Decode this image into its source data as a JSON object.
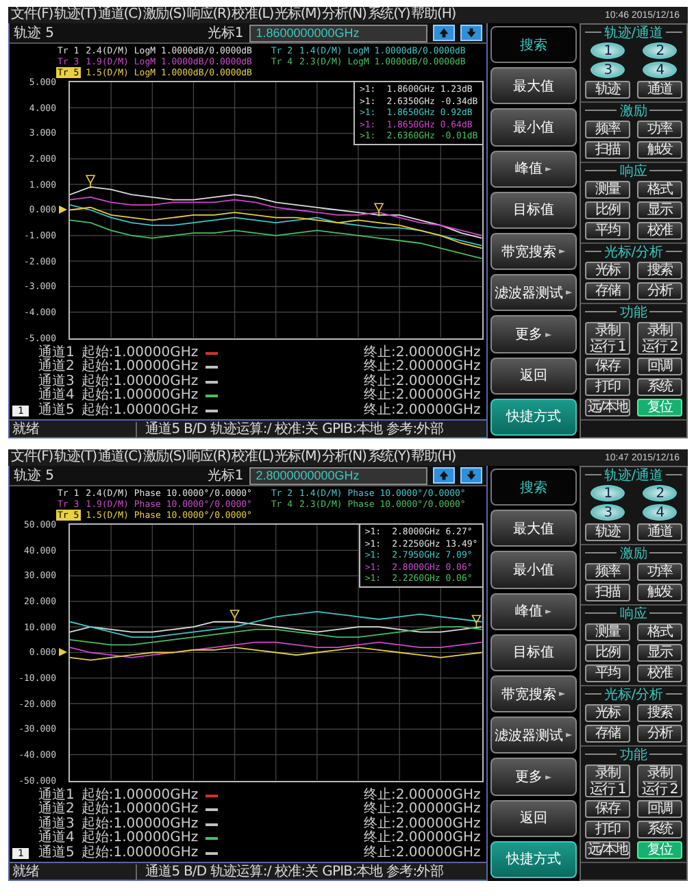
{
  "screens": [
    {
      "menu": [
        "文件(F)",
        "轨迹(T)",
        "通道(C)",
        "激励(S)",
        "响应(R)",
        "校准(L)",
        "光标(M)",
        "分析(N)",
        "系统(Y)",
        "帮助(H)"
      ],
      "time": "10:46 2015/12/16",
      "title": "轨迹 5",
      "marker_label": "光标1",
      "marker_value": "1.8600000000GHz",
      "traces": [
        {
          "label": "Tr 1",
          "text": "2.4(D/M) LogM 1.0000dB/0.0000dB",
          "color": "#e0e0e0",
          "selected": false
        },
        {
          "label": "Tr 2",
          "text": "1.4(D/M) LogM 1.0000dB/0.0000dB",
          "color": "#40c8c8",
          "selected": false
        },
        {
          "label": "Tr 3",
          "text": "1.9(D/M) LogM 1.0000dB/0.0000dB",
          "color": "#d048d0",
          "selected": false
        },
        {
          "label": "Tr 4",
          "text": "2.3(D/M) LogM 1.0000dB/0.0000dB",
          "color": "#48c060",
          "selected": false
        },
        {
          "label": "Tr 5",
          "text": "1.5(D/M) LogM 1.0000dB/0.0000dB",
          "color": "#e8d040",
          "selected": true
        }
      ],
      "chart_data": {
        "type": "line",
        "categories": [
          null,
          null,
          null,
          null,
          null,
          null,
          null,
          null,
          null,
          null,
          null,
          null,
          null,
          null,
          null,
          null,
          null,
          null,
          null,
          null,
          null
        ],
        "ylim": [
          -5,
          5
        ],
        "grid": true,
        "yticks": [
          {
            "value": 5,
            "label": "5.000"
          },
          {
            "value": 4,
            "label": "4.000"
          },
          {
            "value": 3,
            "label": "3.000"
          },
          {
            "value": 2,
            "label": "2.000"
          },
          {
            "value": 1,
            "label": "1.000"
          },
          {
            "value": 0,
            "label": "0.000"
          },
          {
            "value": -1,
            "label": "-1.000"
          },
          {
            "value": -2,
            "label": "-2.000"
          },
          {
            "value": -3,
            "label": "-3.000"
          },
          {
            "value": -4,
            "label": "-4.000"
          },
          {
            "value": -5,
            "label": "-5.000"
          }
        ],
        "series": [
          {
            "color": "#e0e0e0",
            "values": [
              0.6,
              0.9,
              0.8,
              0.6,
              0.5,
              0.4,
              0.4,
              0.5,
              0.6,
              0.5,
              0.3,
              0.2,
              0.1,
              0.0,
              -0.1,
              -0.2,
              -0.2,
              -0.4,
              -0.6,
              -0.9,
              -1.1
            ]
          },
          {
            "color": "#40c8c8",
            "values": [
              0.2,
              0.0,
              -0.3,
              -0.5,
              -0.6,
              -0.6,
              -0.5,
              -0.4,
              -0.3,
              -0.4,
              -0.5,
              -0.4,
              -0.3,
              -0.5,
              -0.6,
              -0.7,
              -0.7,
              -0.8,
              -1.0,
              -1.2,
              -1.4
            ]
          },
          {
            "color": "#d048d0",
            "values": [
              0.4,
              0.5,
              0.3,
              0.2,
              0.2,
              0.3,
              0.3,
              0.3,
              0.4,
              0.3,
              0.1,
              0.0,
              -0.1,
              -0.2,
              -0.2,
              -0.1,
              -0.3,
              -0.5,
              -0.6,
              -0.8,
              -1.0
            ]
          },
          {
            "color": "#48c060",
            "values": [
              -0.4,
              -0.5,
              -0.8,
              -1.0,
              -1.1,
              -1.0,
              -0.9,
              -0.9,
              -0.8,
              -0.9,
              -1.0,
              -0.9,
              -0.8,
              -0.9,
              -1.0,
              -1.1,
              -1.2,
              -1.3,
              -1.5,
              -1.7,
              -1.9
            ]
          },
          {
            "color": "#e8d040",
            "values": [
              0.0,
              0.1,
              -0.2,
              -0.3,
              -0.4,
              -0.3,
              -0.2,
              -0.2,
              -0.1,
              -0.2,
              -0.3,
              -0.3,
              -0.4,
              -0.5,
              -0.4,
              -0.5,
              -0.6,
              -0.8,
              -1.0,
              -1.3,
              -1.5
            ]
          }
        ]
      },
      "markers": [
        {
          "symbol": ">1:",
          "value": "1.8600GHz 1.23dB",
          "color": "#e0e0e0"
        },
        {
          "symbol": ">1:",
          "value": "2.6350GHz -0.34dB",
          "color": "#e0e0e0"
        },
        {
          "symbol": ">1:",
          "value": "1.8650GHz 0.92dB",
          "color": "#40c8c8"
        },
        {
          "symbol": ">1:",
          "value": "1.8650GHz 0.64dB",
          "color": "#d048d0"
        },
        {
          "symbol": ">1:",
          "value": "2.6360GHz -0.01dB",
          "color": "#48c060"
        }
      ],
      "channels": [
        {
          "name": "通道1",
          "start": "起始:1.00000GHz",
          "color": "#d03030",
          "stop": "终止:2.00000GHz"
        },
        {
          "name": "通道2",
          "start": "起始:1.00000GHz",
          "color": "#c0c0c0",
          "stop": "终止:2.00000GHz"
        },
        {
          "name": "通道3",
          "start": "起始:1.00000GHz",
          "color": "#c0c0c0",
          "stop": "终止:2.00000GHz"
        },
        {
          "name": "通道4",
          "start": "起始:1.00000GHz",
          "color": "#48c060",
          "stop": "终止:2.00000GHz"
        },
        {
          "name": "通道5",
          "start": "起始:1.00000GHz",
          "color": "#c0c0c0",
          "stop": "终止:2.00000GHz",
          "badge": "1"
        }
      ],
      "status": {
        "state": "就绪",
        "info": "通道5 B/D 轨迹运算:/ 校准:关 GPIB:本地 参考:外部"
      },
      "softkeys": [
        {
          "label": "搜索",
          "kind": "header"
        },
        {
          "label": "最大值",
          "kind": "normal"
        },
        {
          "label": "最小值",
          "kind": "normal"
        },
        {
          "label": "峰值",
          "kind": "normal",
          "arrow": "►"
        },
        {
          "label": "目标值",
          "kind": "normal"
        },
        {
          "label": "带宽搜索",
          "kind": "normal",
          "arrow": "►"
        },
        {
          "label": "滤波器测试",
          "kind": "normal",
          "arrow": "►"
        },
        {
          "label": "更多",
          "kind": "normal",
          "arrow": "►"
        },
        {
          "label": "返回",
          "kind": "normal"
        },
        {
          "label": "快捷方式",
          "kind": "accent"
        }
      ],
      "groups": [
        {
          "title": "轨迹/通道",
          "buttons": [
            {
              "label": "1",
              "kind": "round"
            },
            {
              "label": "2",
              "kind": "round"
            },
            {
              "label": "3",
              "kind": "round"
            },
            {
              "label": "4",
              "kind": "round"
            },
            {
              "label": "轨迹",
              "kind": "normal"
            },
            {
              "label": "通道",
              "kind": "normal"
            }
          ]
        },
        {
          "title": "激励",
          "buttons": [
            {
              "label": "频率",
              "kind": "normal"
            },
            {
              "label": "功率",
              "kind": "normal"
            },
            {
              "label": "扫描",
              "kind": "normal"
            },
            {
              "label": "触发",
              "kind": "normal"
            }
          ]
        },
        {
          "title": "响应",
          "buttons": [
            {
              "label": "测量",
              "kind": "normal"
            },
            {
              "label": "格式",
              "kind": "normal"
            },
            {
              "label": "比例",
              "kind": "normal"
            },
            {
              "label": "显示",
              "kind": "normal"
            },
            {
              "label": "平均",
              "kind": "normal"
            },
            {
              "label": "校准",
              "kind": "normal"
            }
          ]
        },
        {
          "title": "光标/分析",
          "buttons": [
            {
              "label": "光标",
              "kind": "normal"
            },
            {
              "label": "搜索",
              "kind": "normal"
            },
            {
              "label": "存储",
              "kind": "normal"
            },
            {
              "label": "分析",
              "kind": "normal"
            }
          ]
        },
        {
          "title": "功能",
          "buttons": [
            {
              "label": "录制",
              "sublabel": "运行 1",
              "kind": "double"
            },
            {
              "label": "录制",
              "sublabel": "运行 2",
              "kind": "double"
            },
            {
              "label": "保存",
              "kind": "normal"
            },
            {
              "label": "回调",
              "kind": "normal"
            },
            {
              "label": "打印",
              "kind": "normal"
            },
            {
              "label": "系统",
              "kind": "normal"
            },
            {
              "label": "远/本地",
              "kind": "normal"
            },
            {
              "label": "复位",
              "kind": "accent"
            }
          ]
        }
      ]
    },
    {
      "menu": [
        "文件(F)",
        "轨迹(T)",
        "通道(C)",
        "激励(S)",
        "响应(R)",
        "校准(L)",
        "光标(M)",
        "分析(N)",
        "系统(Y)",
        "帮助(H)"
      ],
      "time": "10:47 2015/12/16",
      "title": "轨迹 5",
      "marker_label": "光标1",
      "marker_value": "2.8000000000GHz",
      "traces": [
        {
          "label": "Tr 1",
          "text": "2.4(D/M) Phase 10.0000°/0.0000°",
          "color": "#e0e0e0",
          "selected": false
        },
        {
          "label": "Tr 2",
          "text": "1.4(D/M) Phase 10.0000°/0.0000°",
          "color": "#40c8c8",
          "selected": false
        },
        {
          "label": "Tr 3",
          "text": "1.9(D/M) Phase 10.0000°/0.0000°",
          "color": "#d048d0",
          "selected": false
        },
        {
          "label": "Tr 4",
          "text": "2.3(D/M) Phase 10.0000°/0.0000°",
          "color": "#48c060",
          "selected": false
        },
        {
          "label": "Tr 5",
          "text": "1.5(D/M) Phase 10.0000°/0.0000°",
          "color": "#e8d040",
          "selected": true
        }
      ],
      "chart_data": {
        "type": "line",
        "categories": [
          null,
          null,
          null,
          null,
          null,
          null,
          null,
          null,
          null,
          null,
          null,
          null,
          null,
          null,
          null,
          null,
          null,
          null,
          null,
          null,
          null
        ],
        "ylim": [
          -50,
          50
        ],
        "grid": true,
        "yticks": [
          {
            "value": 50,
            "label": "50.000"
          },
          {
            "value": 40,
            "label": "40.000"
          },
          {
            "value": 30,
            "label": "30.000"
          },
          {
            "value": 20,
            "label": "20.000"
          },
          {
            "value": 10,
            "label": "10.000"
          },
          {
            "value": 0,
            "label": "0.000"
          },
          {
            "value": -10,
            "label": "-10.000"
          },
          {
            "value": -20,
            "label": "-20.000"
          },
          {
            "value": -30,
            "label": "-30.000"
          },
          {
            "value": -40,
            "label": "-40.000"
          },
          {
            "value": -50,
            "label": "-50.000"
          }
        ],
        "series": [
          {
            "color": "#e0e0e0",
            "values": [
              8,
              10,
              9,
              8,
              8,
              9,
              10,
              12,
              12,
              11,
              10,
              9,
              8,
              9,
              10,
              10,
              9,
              8,
              8,
              9,
              10
            ]
          },
          {
            "color": "#40c8c8",
            "values": [
              12,
              10,
              8,
              6,
              6,
              7,
              8,
              9,
              10,
              12,
              14,
              15,
              16,
              15,
              14,
              13,
              14,
              15,
              14,
              13,
              12
            ]
          },
          {
            "color": "#d048d0",
            "values": [
              2,
              0,
              -1,
              -2,
              -1,
              0,
              1,
              2,
              3,
              4,
              4,
              3,
              2,
              2,
              3,
              4,
              3,
              2,
              2,
              3,
              4
            ]
          },
          {
            "color": "#48c060",
            "values": [
              5,
              4,
              3,
              3,
              4,
              5,
              6,
              7,
              8,
              9,
              9,
              8,
              7,
              6,
              6,
              7,
              8,
              9,
              10,
              10,
              9
            ]
          },
          {
            "color": "#e8d040",
            "values": [
              -2,
              -3,
              -2,
              -1,
              0,
              0,
              1,
              1,
              2,
              1,
              0,
              -1,
              0,
              1,
              2,
              1,
              0,
              -1,
              -2,
              -1,
              0
            ]
          }
        ]
      },
      "markers": [
        {
          "symbol": ">1:",
          "value": "2.8000GHz 6.27°",
          "color": "#e0e0e0"
        },
        {
          "symbol": ">1:",
          "value": "2.2250GHz 13.49°",
          "color": "#e0e0e0"
        },
        {
          "symbol": ">1:",
          "value": "2.7950GHz 7.09°",
          "color": "#40c8c8"
        },
        {
          "symbol": ">1:",
          "value": "2.8000GHz 0.06°",
          "color": "#d048d0"
        },
        {
          "symbol": ">1:",
          "value": "2.2260GHz 0.06°",
          "color": "#48c060"
        }
      ],
      "channels": [
        {
          "name": "通道1",
          "start": "起始:1.00000GHz",
          "color": "#d03030",
          "stop": "终止:2.00000GHz"
        },
        {
          "name": "通道2",
          "start": "起始:1.00000GHz",
          "color": "#c0c0c0",
          "stop": "终止:2.00000GHz"
        },
        {
          "name": "通道3",
          "start": "起始:1.00000GHz",
          "color": "#c0c0c0",
          "stop": "终止:2.00000GHz"
        },
        {
          "name": "通道4",
          "start": "起始:1.00000GHz",
          "color": "#48c060",
          "stop": "终止:2.00000GHz"
        },
        {
          "name": "通道5",
          "start": "起始:1.00000GHz",
          "color": "#c0c0c0",
          "stop": "终止:2.00000GHz",
          "badge": "1"
        }
      ],
      "status": {
        "state": "就绪",
        "info": "通道5 B/D 轨迹运算:/ 校准:关 GPIB:本地 参考:外部"
      },
      "softkeys": [
        {
          "label": "搜索",
          "kind": "header"
        },
        {
          "label": "最大值",
          "kind": "normal"
        },
        {
          "label": "最小值",
          "kind": "normal"
        },
        {
          "label": "峰值",
          "kind": "normal",
          "arrow": "►"
        },
        {
          "label": "目标值",
          "kind": "normal"
        },
        {
          "label": "带宽搜索",
          "kind": "normal",
          "arrow": "►"
        },
        {
          "label": "滤波器测试",
          "kind": "normal",
          "arrow": "►"
        },
        {
          "label": "更多",
          "kind": "normal",
          "arrow": "►"
        },
        {
          "label": "返回",
          "kind": "normal"
        },
        {
          "label": "快捷方式",
          "kind": "accent"
        }
      ],
      "groups": [
        {
          "title": "轨迹/通道",
          "buttons": [
            {
              "label": "1",
              "kind": "round"
            },
            {
              "label": "2",
              "kind": "round"
            },
            {
              "label": "3",
              "kind": "round"
            },
            {
              "label": "4",
              "kind": "round"
            },
            {
              "label": "轨迹",
              "kind": "normal"
            },
            {
              "label": "通道",
              "kind": "normal"
            }
          ]
        },
        {
          "title": "激励",
          "buttons": [
            {
              "label": "频率",
              "kind": "normal"
            },
            {
              "label": "功率",
              "kind": "normal"
            },
            {
              "label": "扫描",
              "kind": "normal"
            },
            {
              "label": "触发",
              "kind": "normal"
            }
          ]
        },
        {
          "title": "响应",
          "buttons": [
            {
              "label": "测量",
              "kind": "normal"
            },
            {
              "label": "格式",
              "kind": "normal"
            },
            {
              "label": "比例",
              "kind": "normal"
            },
            {
              "label": "显示",
              "kind": "normal"
            },
            {
              "label": "平均",
              "kind": "normal"
            },
            {
              "label": "校准",
              "kind": "normal"
            }
          ]
        },
        {
          "title": "光标/分析",
          "buttons": [
            {
              "label": "光标",
              "kind": "normal"
            },
            {
              "label": "搜索",
              "kind": "normal"
            },
            {
              "label": "存储",
              "kind": "normal"
            },
            {
              "label": "分析",
              "kind": "normal"
            }
          ]
        },
        {
          "title": "功能",
          "buttons": [
            {
              "label": "录制",
              "sublabel": "运行 1",
              "kind": "double"
            },
            {
              "label": "录制",
              "sublabel": "运行 2",
              "kind": "double"
            },
            {
              "label": "保存",
              "kind": "normal"
            },
            {
              "label": "回调",
              "kind": "normal"
            },
            {
              "label": "打印",
              "kind": "normal"
            },
            {
              "label": "系统",
              "kind": "normal"
            },
            {
              "label": "远/本地",
              "kind": "normal"
            },
            {
              "label": "复位",
              "kind": "accent"
            }
          ]
        }
      ]
    }
  ]
}
